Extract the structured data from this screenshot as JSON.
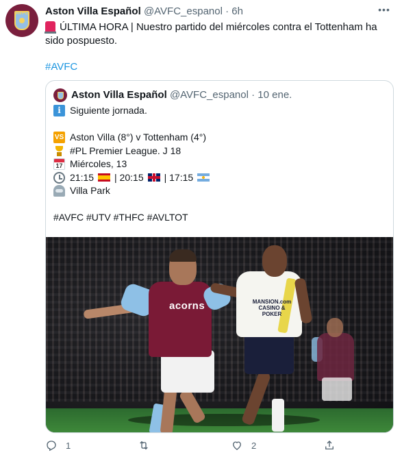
{
  "tweet": {
    "author_name": "Aston Villa Español",
    "handle": "@AVFC_espanol",
    "separator": "·",
    "time": "6h",
    "avatar_text": "AVFC",
    "text": "ÚLTIMA HORA | Nuestro partido del miércoles contra el Tottenham ha sido pospuesto.",
    "hashtag": "#AVFC",
    "icons": {
      "more": "more-icon",
      "alert": "rotating-light-icon"
    }
  },
  "quote": {
    "author_name": "Aston Villa Español",
    "handle": "@AVFC_espanol",
    "separator": "·",
    "date": "10 ene.",
    "lines": {
      "intro": "Siguiente jornada.",
      "match": "Aston Villa (8°) v Tottenham (4°)",
      "competition": "#PL Premier League. J 18",
      "day": "Miércoles, 13",
      "time_es": "21:15",
      "time_uk": "| 20:15",
      "time_ar": "| 17:15",
      "venue": "Villa Park",
      "hashtags": "#AVFC #UTV #THFC #AVLTOT"
    },
    "calendar_icon_text": "17",
    "vs_icon_text": "VS",
    "info_icon_text": "i",
    "photo": {
      "shirt_sponsor": "acorns",
      "opponent_sponsor": "MANSION.com CASINO & POKER"
    }
  },
  "actions": {
    "reply_count": "1",
    "retweet_count": "",
    "like_count": "2",
    "icons": [
      "reply-icon",
      "retweet-icon",
      "like-icon",
      "share-icon"
    ]
  },
  "colors": {
    "link": "#1b95e0",
    "secondary_text": "#536471",
    "border": "#cfd9de",
    "villa_claret": "#7a1f3d",
    "villa_blue": "#95bfe5"
  }
}
